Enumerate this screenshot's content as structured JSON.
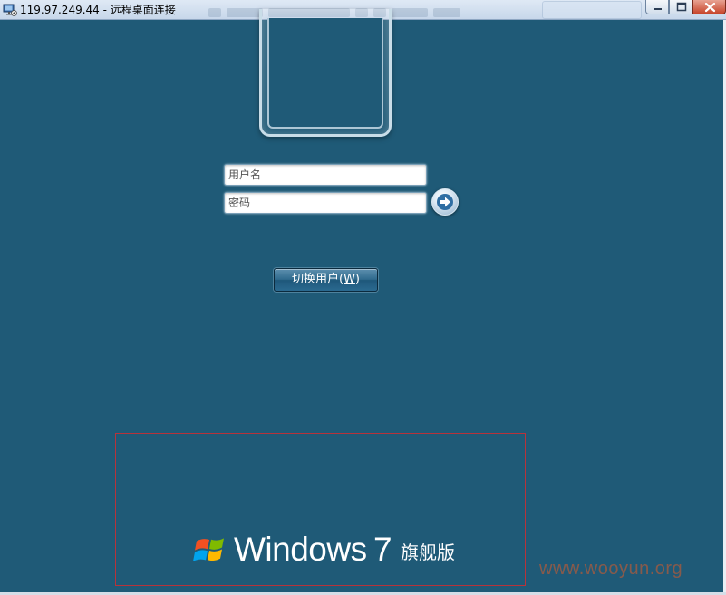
{
  "window": {
    "title": "119.97.249.44 - 远程桌面连接",
    "icon": "remote-desktop-icon",
    "controls": {
      "minimize": "minimize-icon",
      "maximize": "maximize-icon",
      "close": "close-icon"
    }
  },
  "login": {
    "username_placeholder": "用户名",
    "username_value": "",
    "password_placeholder": "密码",
    "password_value": "",
    "submit_icon": "arrow-right-icon",
    "switch_user_label": "切换用户(",
    "switch_user_mnemonic": "W",
    "switch_user_suffix": ")"
  },
  "branding": {
    "logo_icon": "windows-flag-icon",
    "product": "Windows",
    "version": "7",
    "edition": "旗舰版"
  },
  "watermark": "www.wooyun.org",
  "colors": {
    "background": "#1f5a77",
    "highlight_box": "#b8323a"
  }
}
